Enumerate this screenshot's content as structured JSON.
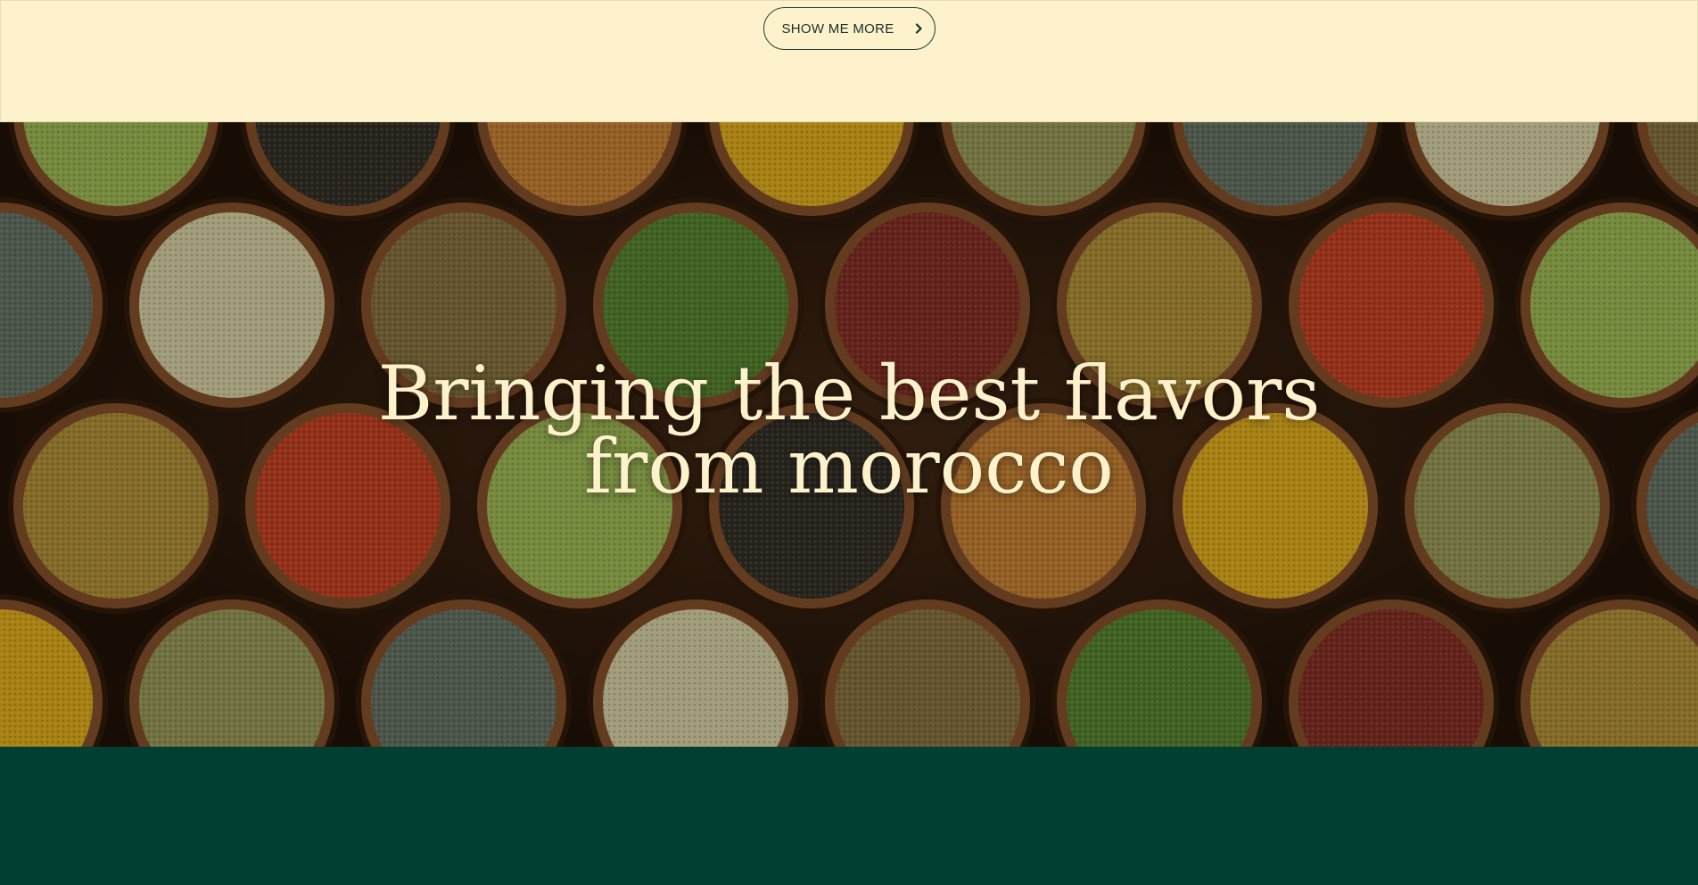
{
  "top": {
    "show_more_label": "SHOW ME MORE",
    "button_icon": "chevron-right-icon"
  },
  "hero": {
    "title_line1": "Bringing the best flavors",
    "title_line2": "from morocco",
    "image": "spice-bowls-photo"
  },
  "colors": {
    "cream": "#fdf2cc",
    "dark_green": "#023f33",
    "button_text": "#1a2e28"
  }
}
